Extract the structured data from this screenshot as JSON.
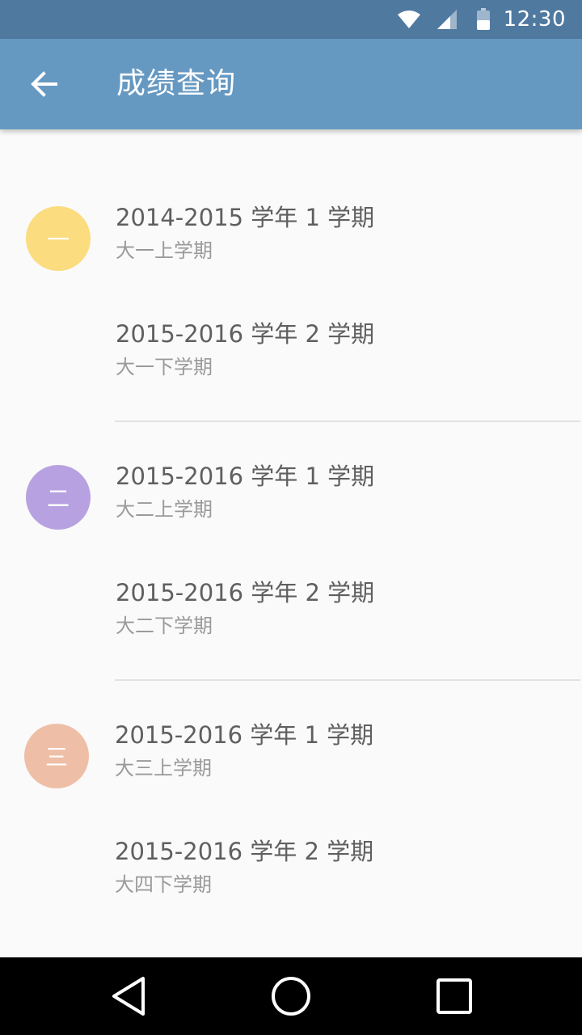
{
  "status_bar": {
    "time": "12:30",
    "icons": [
      "wifi-icon",
      "cell-signal-icon",
      "battery-icon"
    ]
  },
  "app_bar": {
    "title": "成绩查询",
    "back_icon": "arrow-left-icon",
    "color": "#6699c2"
  },
  "groups": [
    {
      "badge": "一",
      "badge_color": "#fbdc7e",
      "items": [
        {
          "title": "2014-2015 学年 1 学期",
          "subtitle": "大一上学期"
        },
        {
          "title": "2015-2016 学年 2 学期",
          "subtitle": "大一下学期"
        }
      ]
    },
    {
      "badge": "二",
      "badge_color": "#b7a1e0",
      "items": [
        {
          "title": "2015-2016 学年 1 学期",
          "subtitle": "大二上学期"
        },
        {
          "title": "2015-2016 学年 2 学期",
          "subtitle": "大二下学期"
        }
      ]
    },
    {
      "badge": "三",
      "badge_color": "#eebfa6",
      "items": [
        {
          "title": "2015-2016 学年 1 学期",
          "subtitle": "大三上学期"
        },
        {
          "title": "2015-2016 学年 2 学期",
          "subtitle": "大四下学期"
        }
      ]
    }
  ],
  "nav_bar": {
    "icons": [
      "back-triangle-icon",
      "home-circle-icon",
      "recents-square-icon"
    ]
  }
}
